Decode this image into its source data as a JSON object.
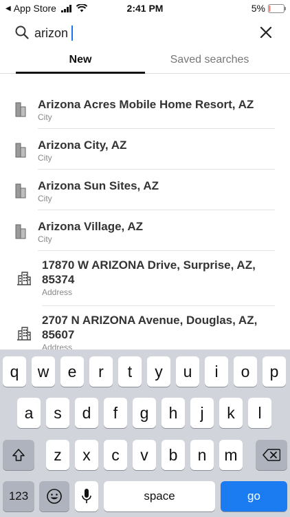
{
  "status_bar": {
    "back_label": "App Store",
    "time": "2:41 PM",
    "battery": "5%",
    "battery_level": 0.05,
    "battery_color": "#e53935"
  },
  "search": {
    "value": "arizon",
    "search_icon": "search-icon",
    "close_icon": "close-icon"
  },
  "tabs": [
    {
      "label": "New",
      "active": true
    },
    {
      "label": "Saved searches",
      "active": false
    }
  ],
  "results": [
    {
      "title": "Arizona Acres Mobile Home Resort, AZ",
      "type": "City",
      "icon": "city-icon"
    },
    {
      "title": "Arizona City, AZ",
      "type": "City",
      "icon": "city-icon"
    },
    {
      "title": "Arizona Sun Sites, AZ",
      "type": "City",
      "icon": "city-icon"
    },
    {
      "title": "Arizona Village, AZ",
      "type": "City",
      "icon": "city-icon"
    },
    {
      "title": "17870 W ARIZONA Drive, Surprise, AZ, 85374",
      "type": "Address",
      "icon": "building-icon"
    },
    {
      "title": "2707 N ARIZONA Avenue, Douglas, AZ, 85607",
      "type": "Address",
      "icon": "building-icon"
    }
  ],
  "keyboard": {
    "row1": [
      "q",
      "w",
      "e",
      "r",
      "t",
      "y",
      "u",
      "i",
      "o",
      "p"
    ],
    "row2": [
      "a",
      "s",
      "d",
      "f",
      "g",
      "h",
      "j",
      "k",
      "l"
    ],
    "row3": [
      "z",
      "x",
      "c",
      "v",
      "b",
      "n",
      "m"
    ],
    "num_label": "123",
    "space_label": "space",
    "go_label": "go",
    "accent_color": "#1a7cf0"
  }
}
